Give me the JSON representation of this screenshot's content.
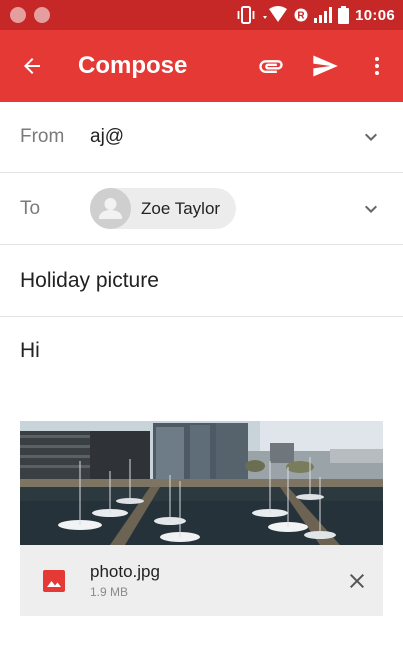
{
  "status_bar": {
    "time": "10:06",
    "icons": [
      "notification-dot-icon",
      "notification-dot-icon",
      "vibrate-icon",
      "wifi-icon",
      "roaming-icon",
      "signal-icon",
      "battery-icon"
    ],
    "roaming_label": "R"
  },
  "app_bar": {
    "title": "Compose",
    "icons": [
      "back-arrow-icon",
      "attach-icon",
      "send-icon",
      "more-vert-icon"
    ],
    "color": "#e53935",
    "status_color": "#c62828"
  },
  "from": {
    "label": "From",
    "value": "aj@"
  },
  "to": {
    "label": "To",
    "recipient": "Zoe Taylor"
  },
  "subject": "Holiday picture",
  "body": "Hi",
  "attachment": {
    "file_name": "photo.jpg",
    "file_size": "1.9 MB",
    "icon": "image-file-icon",
    "icon_color": "#e53935"
  }
}
